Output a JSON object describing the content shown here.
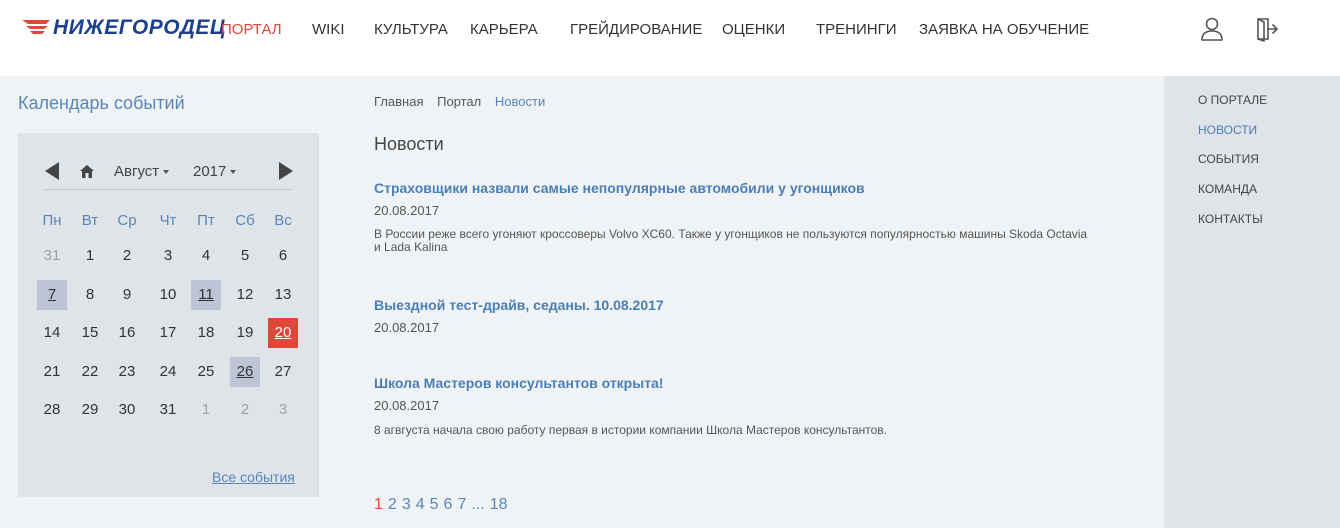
{
  "header": {
    "logo_text": "НИЖЕГОРОДЕЦ",
    "nav": [
      {
        "label": "ПОРТАЛ",
        "active": true
      },
      {
        "label": "WIKI",
        "active": false
      },
      {
        "label": "КУЛЬТУРА",
        "active": false
      },
      {
        "label": "КАРЬЕРА",
        "active": false
      },
      {
        "label": "ГРЕЙДИРОВАНИЕ",
        "active": false
      },
      {
        "label": "ОЦЕНКИ",
        "active": false
      },
      {
        "label": "ТРЕНИНГИ",
        "active": false
      },
      {
        "label": "ЗАЯВКА НА ОБУЧЕНИЕ",
        "active": false
      }
    ],
    "icons": [
      "user-icon",
      "logout-icon"
    ]
  },
  "calendar": {
    "title": "Календарь событий",
    "month": "Август",
    "year": "2017",
    "weekdays": [
      "Пн",
      "Вт",
      "Ср",
      "Чт",
      "Пт",
      "Сб",
      "Вс"
    ],
    "weeks": [
      [
        {
          "d": "31",
          "muted": true
        },
        {
          "d": "1"
        },
        {
          "d": "2"
        },
        {
          "d": "3"
        },
        {
          "d": "4"
        },
        {
          "d": "5"
        },
        {
          "d": "6"
        }
      ],
      [
        {
          "d": "7",
          "event": true
        },
        {
          "d": "8"
        },
        {
          "d": "9"
        },
        {
          "d": "10"
        },
        {
          "d": "11",
          "event": true
        },
        {
          "d": "12"
        },
        {
          "d": "13"
        }
      ],
      [
        {
          "d": "14"
        },
        {
          "d": "15"
        },
        {
          "d": "16"
        },
        {
          "d": "17"
        },
        {
          "d": "18"
        },
        {
          "d": "19"
        },
        {
          "d": "20",
          "today": true
        }
      ],
      [
        {
          "d": "21"
        },
        {
          "d": "22"
        },
        {
          "d": "23"
        },
        {
          "d": "24"
        },
        {
          "d": "25"
        },
        {
          "d": "26",
          "event": true
        },
        {
          "d": "27"
        }
      ],
      [
        {
          "d": "28"
        },
        {
          "d": "29"
        },
        {
          "d": "30"
        },
        {
          "d": "31"
        },
        {
          "d": "1",
          "muted": true
        },
        {
          "d": "2",
          "muted": true
        },
        {
          "d": "3",
          "muted": true
        }
      ]
    ],
    "all_events_label": "Все события"
  },
  "breadcrumb": [
    {
      "label": "Главная",
      "current": false
    },
    {
      "label": "Портал",
      "current": false
    },
    {
      "label": "Новости",
      "current": true
    }
  ],
  "page_title": "Новости",
  "news": [
    {
      "title": "Страховщики назвали самые непопулярные автомобили у угонщиков",
      "date": "20.08.2017",
      "text": "В России реже всего угоняют кроссоверы Volvo XC60. Также у угонщиков не пользуются популярностью машины Skoda Octavia и Lada Kalina"
    },
    {
      "title": "Выездной тест-драйв, седаны. 10.08.2017",
      "date": "20.08.2017",
      "text": ""
    },
    {
      "title": "Школа Мастеров консультантов открыта!",
      "date": "20.08.2017",
      "text": "8 агвгуста начала свою работу первая в истории компании Школа Мастеров консультантов."
    }
  ],
  "pagination": {
    "pages": [
      "1",
      "2",
      "3",
      "4",
      "5",
      "6",
      "7",
      "...",
      "18"
    ],
    "current": "1"
  },
  "sidebar": {
    "items": [
      {
        "label": "О ПОРТАЛЕ",
        "active": false
      },
      {
        "label": "НОВОСТИ",
        "active": true
      },
      {
        "label": "СОБЫТИЯ",
        "active": false
      },
      {
        "label": "КОМАНДА",
        "active": false
      },
      {
        "label": "КОНТАКТЫ",
        "active": false
      }
    ]
  },
  "colors": {
    "accent": "#e0473a",
    "link": "#4a7fb5",
    "brand": "#1d3f8f",
    "event_day": "#bcc4d6"
  }
}
